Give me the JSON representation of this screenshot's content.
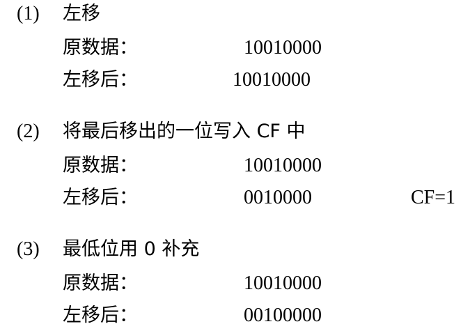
{
  "sections": [
    {
      "number": "(1)",
      "heading": "左移",
      "original_label": "原数据：",
      "original_value": "10010000",
      "shifted_label": "左移后：",
      "shifted_value": "10010000"
    },
    {
      "number": "(2)",
      "heading": "将最后移出的一位写入 CF 中",
      "original_label": "原数据：",
      "original_value": "10010000",
      "shifted_label": "左移后：",
      "shifted_value": "0010000",
      "flag": "CF=1"
    },
    {
      "number": "(3)",
      "heading": "最低位用 0 补充",
      "original_label": "原数据：",
      "original_value": "10010000",
      "shifted_label": "左移后：",
      "shifted_value": "00100000"
    }
  ]
}
